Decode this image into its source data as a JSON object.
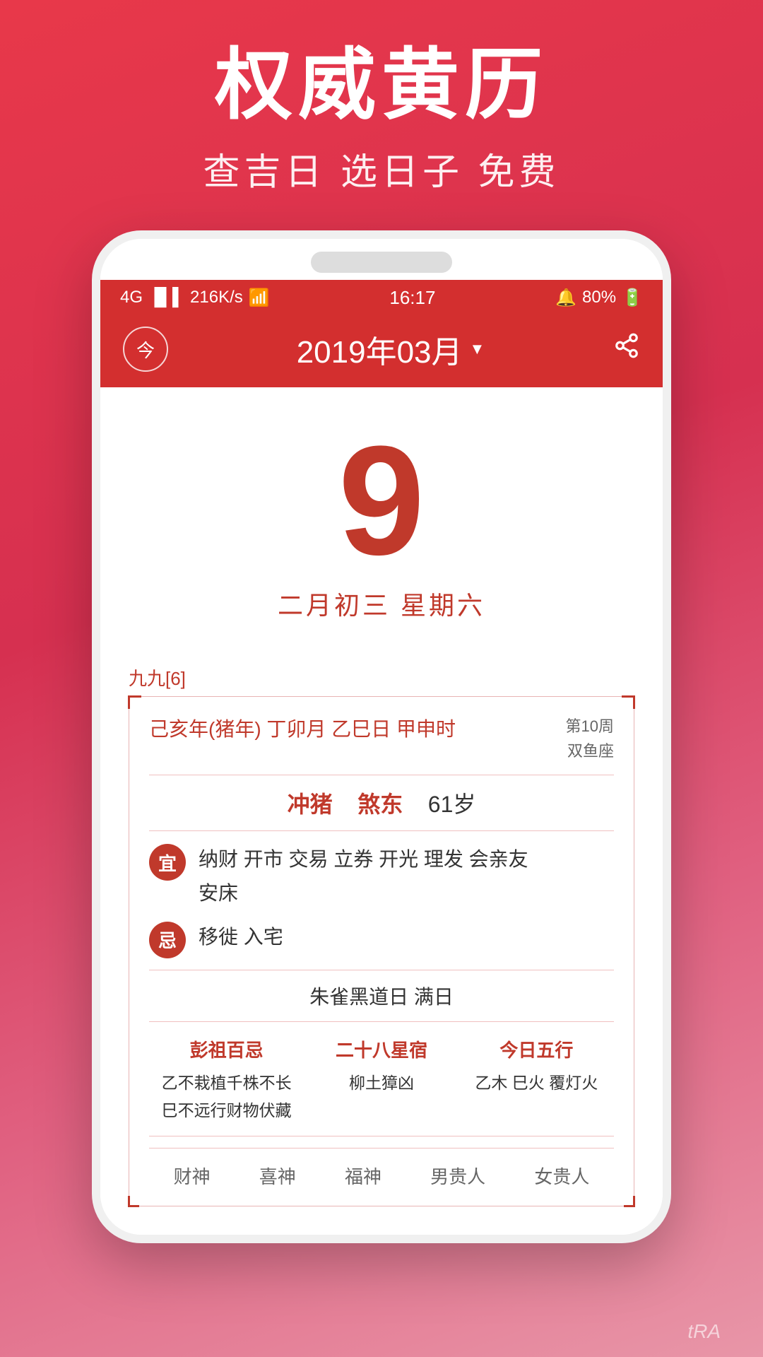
{
  "app": {
    "main_title": "权威黄历",
    "sub_title": "查吉日 选日子 免费"
  },
  "status_bar": {
    "signal": "4G",
    "speed": "216K/s",
    "wifi": "wifi",
    "time": "16:17",
    "alarm": "🔔",
    "battery": "80%"
  },
  "header": {
    "today_label": "今",
    "month_title": "2019年03月",
    "dropdown_arrow": "▼"
  },
  "calendar": {
    "big_number": "9",
    "lunar_date": "二月初三  星期六",
    "jiujiu": "九九[6]",
    "ganzhi": "己亥年(猪年) 丁卯月 乙巳日 甲申时",
    "week": "第10周",
    "zodiac": "双鱼座",
    "chong": "冲猪",
    "sha": "煞东",
    "age": "61岁",
    "yi_label": "宜",
    "yi_text": "纳财 开市 交易 立券 开光 理发 会亲友\n安床",
    "ji_label": "忌",
    "ji_text": "移徙 入宅",
    "zhuri": "朱雀黑道日  满日",
    "pengzu_title": "彭祖百忌",
    "pengzu_line1": "乙不栽植千株不长",
    "pengzu_line2": "巳不远行财物伏藏",
    "xiu_title": "二十八星宿",
    "xiu_content": "柳土獐凶",
    "wuxing_title": "今日五行",
    "wuxing_content": "乙木 巳火 覆灯火",
    "footer_items": [
      "财神",
      "喜神",
      "福神",
      "男贵人",
      "女贵人"
    ],
    "watermark": "tRA"
  }
}
